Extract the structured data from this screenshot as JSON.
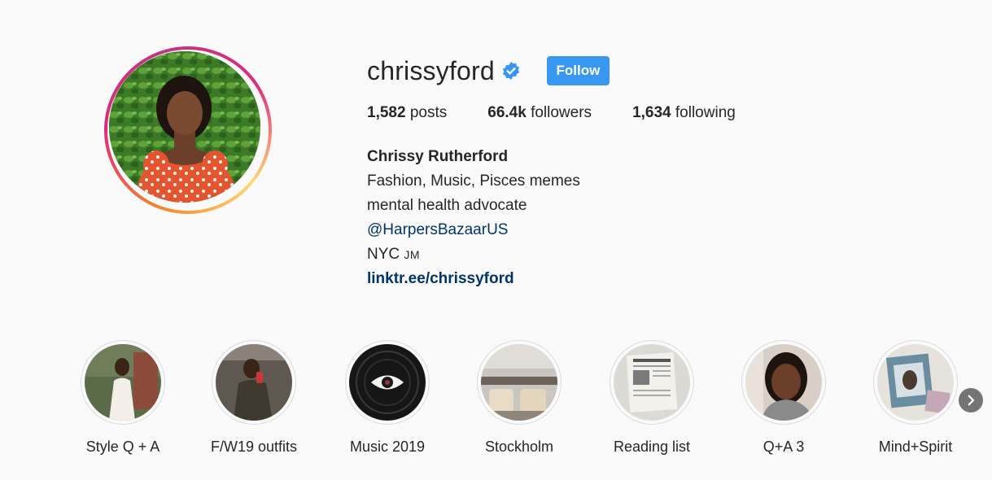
{
  "profile": {
    "username": "chrissyford",
    "verified_icon": "verified-badge-icon",
    "follow_label": "Follow",
    "accent_color": "#3897f0",
    "stats": {
      "posts_count": "1,582",
      "posts_label": "posts",
      "followers_count": "66.4k",
      "followers_label": "followers",
      "following_count": "1,634",
      "following_label": "following"
    },
    "bio": {
      "full_name": "Chrissy Rutherford",
      "line1": "Fashion, Music, Pisces memes",
      "line2": "mental health advocate",
      "mention": "@HarpersBazaarUS",
      "location": "NYC",
      "location_flag": "JM",
      "website": "linktr.ee/chrissyford"
    }
  },
  "highlights": [
    {
      "label": "Style Q + A"
    },
    {
      "label": "F/W19 outfits"
    },
    {
      "label": "Music 2019"
    },
    {
      "label": "Stockholm"
    },
    {
      "label": "Reading list"
    },
    {
      "label": "Q+A 3"
    },
    {
      "label": "Mind+Spirit"
    }
  ],
  "navigation": {
    "next_icon": "chevron-right-icon"
  }
}
